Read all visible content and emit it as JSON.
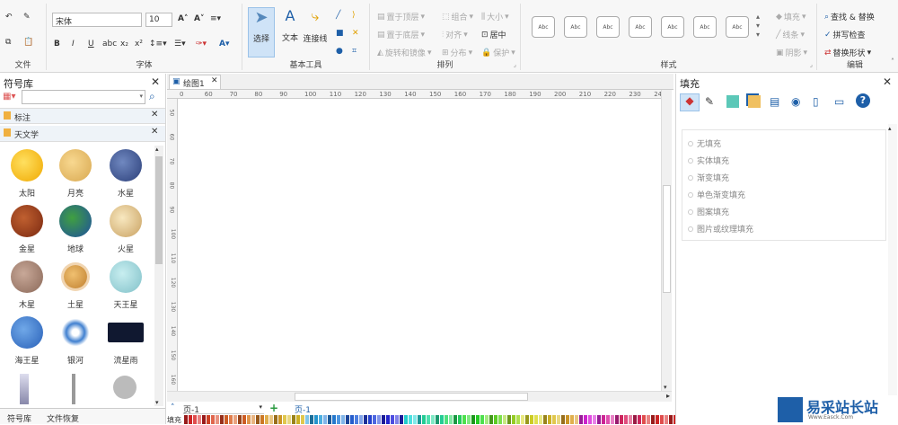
{
  "ribbon": {
    "groups": {
      "file": "文件",
      "font": "字体",
      "basic_tools": "基本工具",
      "arrange": "排列",
      "style": "样式",
      "edit": "编辑"
    },
    "font_name": "宋体",
    "font_size": "10",
    "select": "选择",
    "text": "文本",
    "connector": "连接线",
    "bring_front": "置于顶层",
    "send_back": "置于底层",
    "rotate_mirror": "旋转和镜像",
    "group": "组合",
    "align": "对齐",
    "distribute": "分布",
    "size": "大小",
    "center": "居中",
    "protect": "保护",
    "style_sample": "Abc",
    "fill": "填充",
    "line": "线条",
    "shadow": "阴影",
    "find_replace": "查找 & 替换",
    "spell_check": "拼写检查",
    "replace_shape": "替换形状"
  },
  "left_panel": {
    "title": "符号库",
    "categories": [
      "标注",
      "天文学"
    ],
    "items": [
      "太阳",
      "月亮",
      "水星",
      "金星",
      "地球",
      "火星",
      "木星",
      "土星",
      "天王星",
      "海王星",
      "银河",
      "流星雨"
    ],
    "tabs": [
      "符号库",
      "文件恢复"
    ]
  },
  "canvas": {
    "doc_tab": "绘图1",
    "ruler_h": [
      "0",
      "60",
      "70",
      "80",
      "90",
      "100",
      "110",
      "120",
      "130",
      "140",
      "150",
      "160",
      "170",
      "180",
      "190",
      "200",
      "210",
      "220",
      "230",
      "240"
    ],
    "ruler_v": [
      "50",
      "60",
      "70",
      "80",
      "90",
      "100",
      "110",
      "120",
      "130",
      "140",
      "150",
      "160"
    ],
    "page_selector": "页-1",
    "page_tab": "页-1",
    "fill_label": "填充"
  },
  "right_panel": {
    "title": "填充",
    "options": [
      "无填充",
      "实体填充",
      "渐变填充",
      "单色渐变填充",
      "图案填充",
      "图片或纹理填充"
    ]
  },
  "watermark": {
    "name": "易采站长站",
    "url": "Www.Easck.Com"
  },
  "colors": {
    "ribbon_bg": "#f7f7f7",
    "accent": "#1e5fa8",
    "highlight": "#cfe3f7"
  }
}
